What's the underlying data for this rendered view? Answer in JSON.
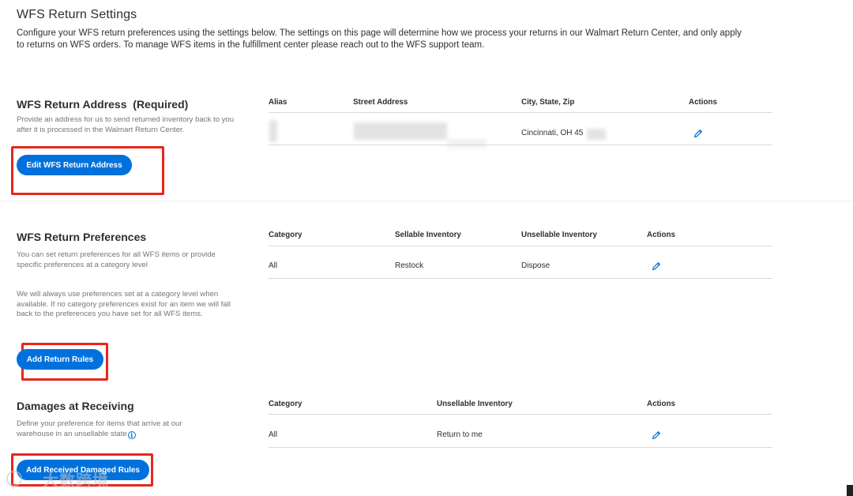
{
  "page": {
    "title": "WFS Return Settings",
    "description": "Configure your WFS return preferences using the settings below. The settings on this page will determine how we process your returns in our Walmart Return Center, and only apply to returns on WFS orders. To manage WFS items in the fulfillment center please reach out to the WFS support team."
  },
  "return_address": {
    "title": "WFS Return Address",
    "required_label": "(Required)",
    "description": "Provide an address for us to send returned inventory back to you after it is processed in the Walmart Return Center.",
    "button_label": "Edit WFS Return Address",
    "columns": [
      "Alias",
      "Street Address",
      "City, State, Zip",
      "Actions"
    ],
    "rows": [
      {
        "alias": "",
        "street": "",
        "city": "Cincinnati, OH 45"
      }
    ]
  },
  "preferences": {
    "title": "WFS Return Preferences",
    "description_1": "You can set return preferences for all WFS items or provide specific preferences at a category level",
    "description_2": "We will always use preferences set at a category level when available. If no category preferences exist for an item we will fall back to the preferences you have set for all WFS items.",
    "button_label": "Add Return Rules",
    "columns": [
      "Category",
      "Sellable Inventory",
      "Unsellable Inventory",
      "Actions"
    ],
    "rows": [
      {
        "category": "All",
        "sellable": "Restock",
        "unsellable": "Dispose"
      }
    ]
  },
  "damages": {
    "title": "Damages at Receiving",
    "description": "Define your preference for items that arrive at our warehouse in an unsellable state",
    "info_glyph": "i",
    "button_label": "Add Received Damaged Rules",
    "columns": [
      "Category",
      "Unsellable Inventory",
      "Actions"
    ],
    "rows": [
      {
        "category": "All",
        "unsellable": "Return to me"
      }
    ]
  },
  "icons": {
    "edit": "pencil-icon",
    "info": "info-icon"
  },
  "colors": {
    "primary": "#0071dc",
    "highlight": "#e8261c",
    "text": "#2e2f32",
    "muted": "#74767c"
  },
  "watermark": {
    "text": "大数跨境"
  }
}
